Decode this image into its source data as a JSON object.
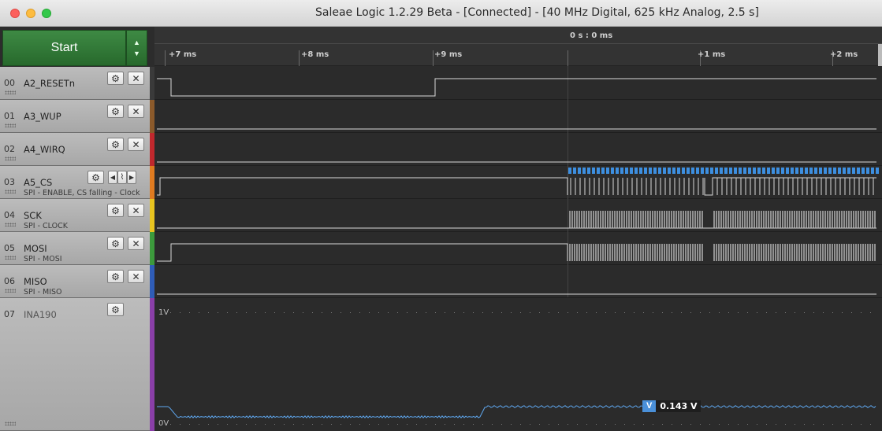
{
  "window": {
    "title": "Saleae Logic 1.2.29 Beta - [Connected] - [40 MHz Digital, 625 kHz Analog, 2.5 s]"
  },
  "controls": {
    "start_label": "Start"
  },
  "timeline": {
    "center_time": "0 s : 0 ms",
    "ticks": [
      "+7 ms",
      "+8 ms",
      "+9 ms",
      "+1 ms",
      "+2 ms"
    ]
  },
  "channels": [
    {
      "num": "00",
      "name": "A2_RESETn",
      "sub": "",
      "color": "#3a3a3a"
    },
    {
      "num": "01",
      "name": "A3_WUP",
      "sub": "",
      "color": "#8b5a2b"
    },
    {
      "num": "02",
      "name": "A4_WIRQ",
      "sub": "",
      "color": "#c0282d"
    },
    {
      "num": "03",
      "name": "A5_CS",
      "sub": "SPI - ENABLE, CS falling - Clock",
      "color": "#e07b20"
    },
    {
      "num": "04",
      "name": "SCK",
      "sub": "SPI - CLOCK",
      "color": "#e8c420"
    },
    {
      "num": "05",
      "name": "MOSI",
      "sub": "SPI - MOSI",
      "color": "#3c9a3c"
    },
    {
      "num": "06",
      "name": "MISO",
      "sub": "SPI - MISO",
      "color": "#2f5db8"
    },
    {
      "num": "07",
      "name": "INA190",
      "sub": "",
      "color": "#8a3fa8"
    }
  ],
  "analog": {
    "top_label": "1V",
    "bottom_label": "0V",
    "measurement_tag": "V",
    "measurement_value": "0.143 V"
  }
}
